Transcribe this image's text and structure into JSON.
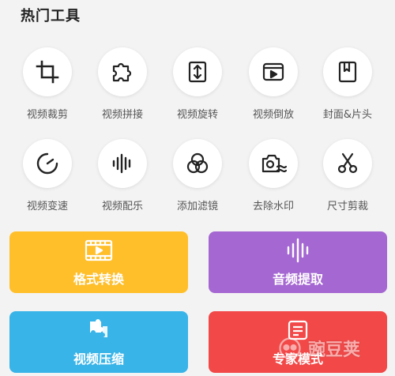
{
  "section": {
    "title": "热门工具"
  },
  "tools": [
    {
      "label": "视频裁剪",
      "icon": "crop-icon"
    },
    {
      "label": "视频拼接",
      "icon": "puzzle-icon"
    },
    {
      "label": "视频旋转",
      "icon": "rotate-icon"
    },
    {
      "label": "视频倒放",
      "icon": "reverse-play-icon"
    },
    {
      "label": "封面&片头",
      "icon": "bookmark-icon"
    },
    {
      "label": "视频变速",
      "icon": "speedometer-icon"
    },
    {
      "label": "视频配乐",
      "icon": "audio-wave-icon"
    },
    {
      "label": "添加滤镜",
      "icon": "filter-circles-icon"
    },
    {
      "label": "去除水印",
      "icon": "camera-wave-icon"
    },
    {
      "label": "尺寸剪裁",
      "icon": "scissors-icon"
    }
  ],
  "cards": [
    {
      "label": "格式转换",
      "icon": "film-icon",
      "color": "#ffbf2b"
    },
    {
      "label": "音频提取",
      "icon": "sound-bars-icon",
      "color": "#a567d2"
    },
    {
      "label": "视频压缩",
      "icon": "compress-puzzle-icon",
      "color": "#38b4e8"
    },
    {
      "label": "专家模式",
      "icon": "expert-icon",
      "color": "#f24848"
    }
  ],
  "watermark": {
    "text": "豌豆荚"
  }
}
